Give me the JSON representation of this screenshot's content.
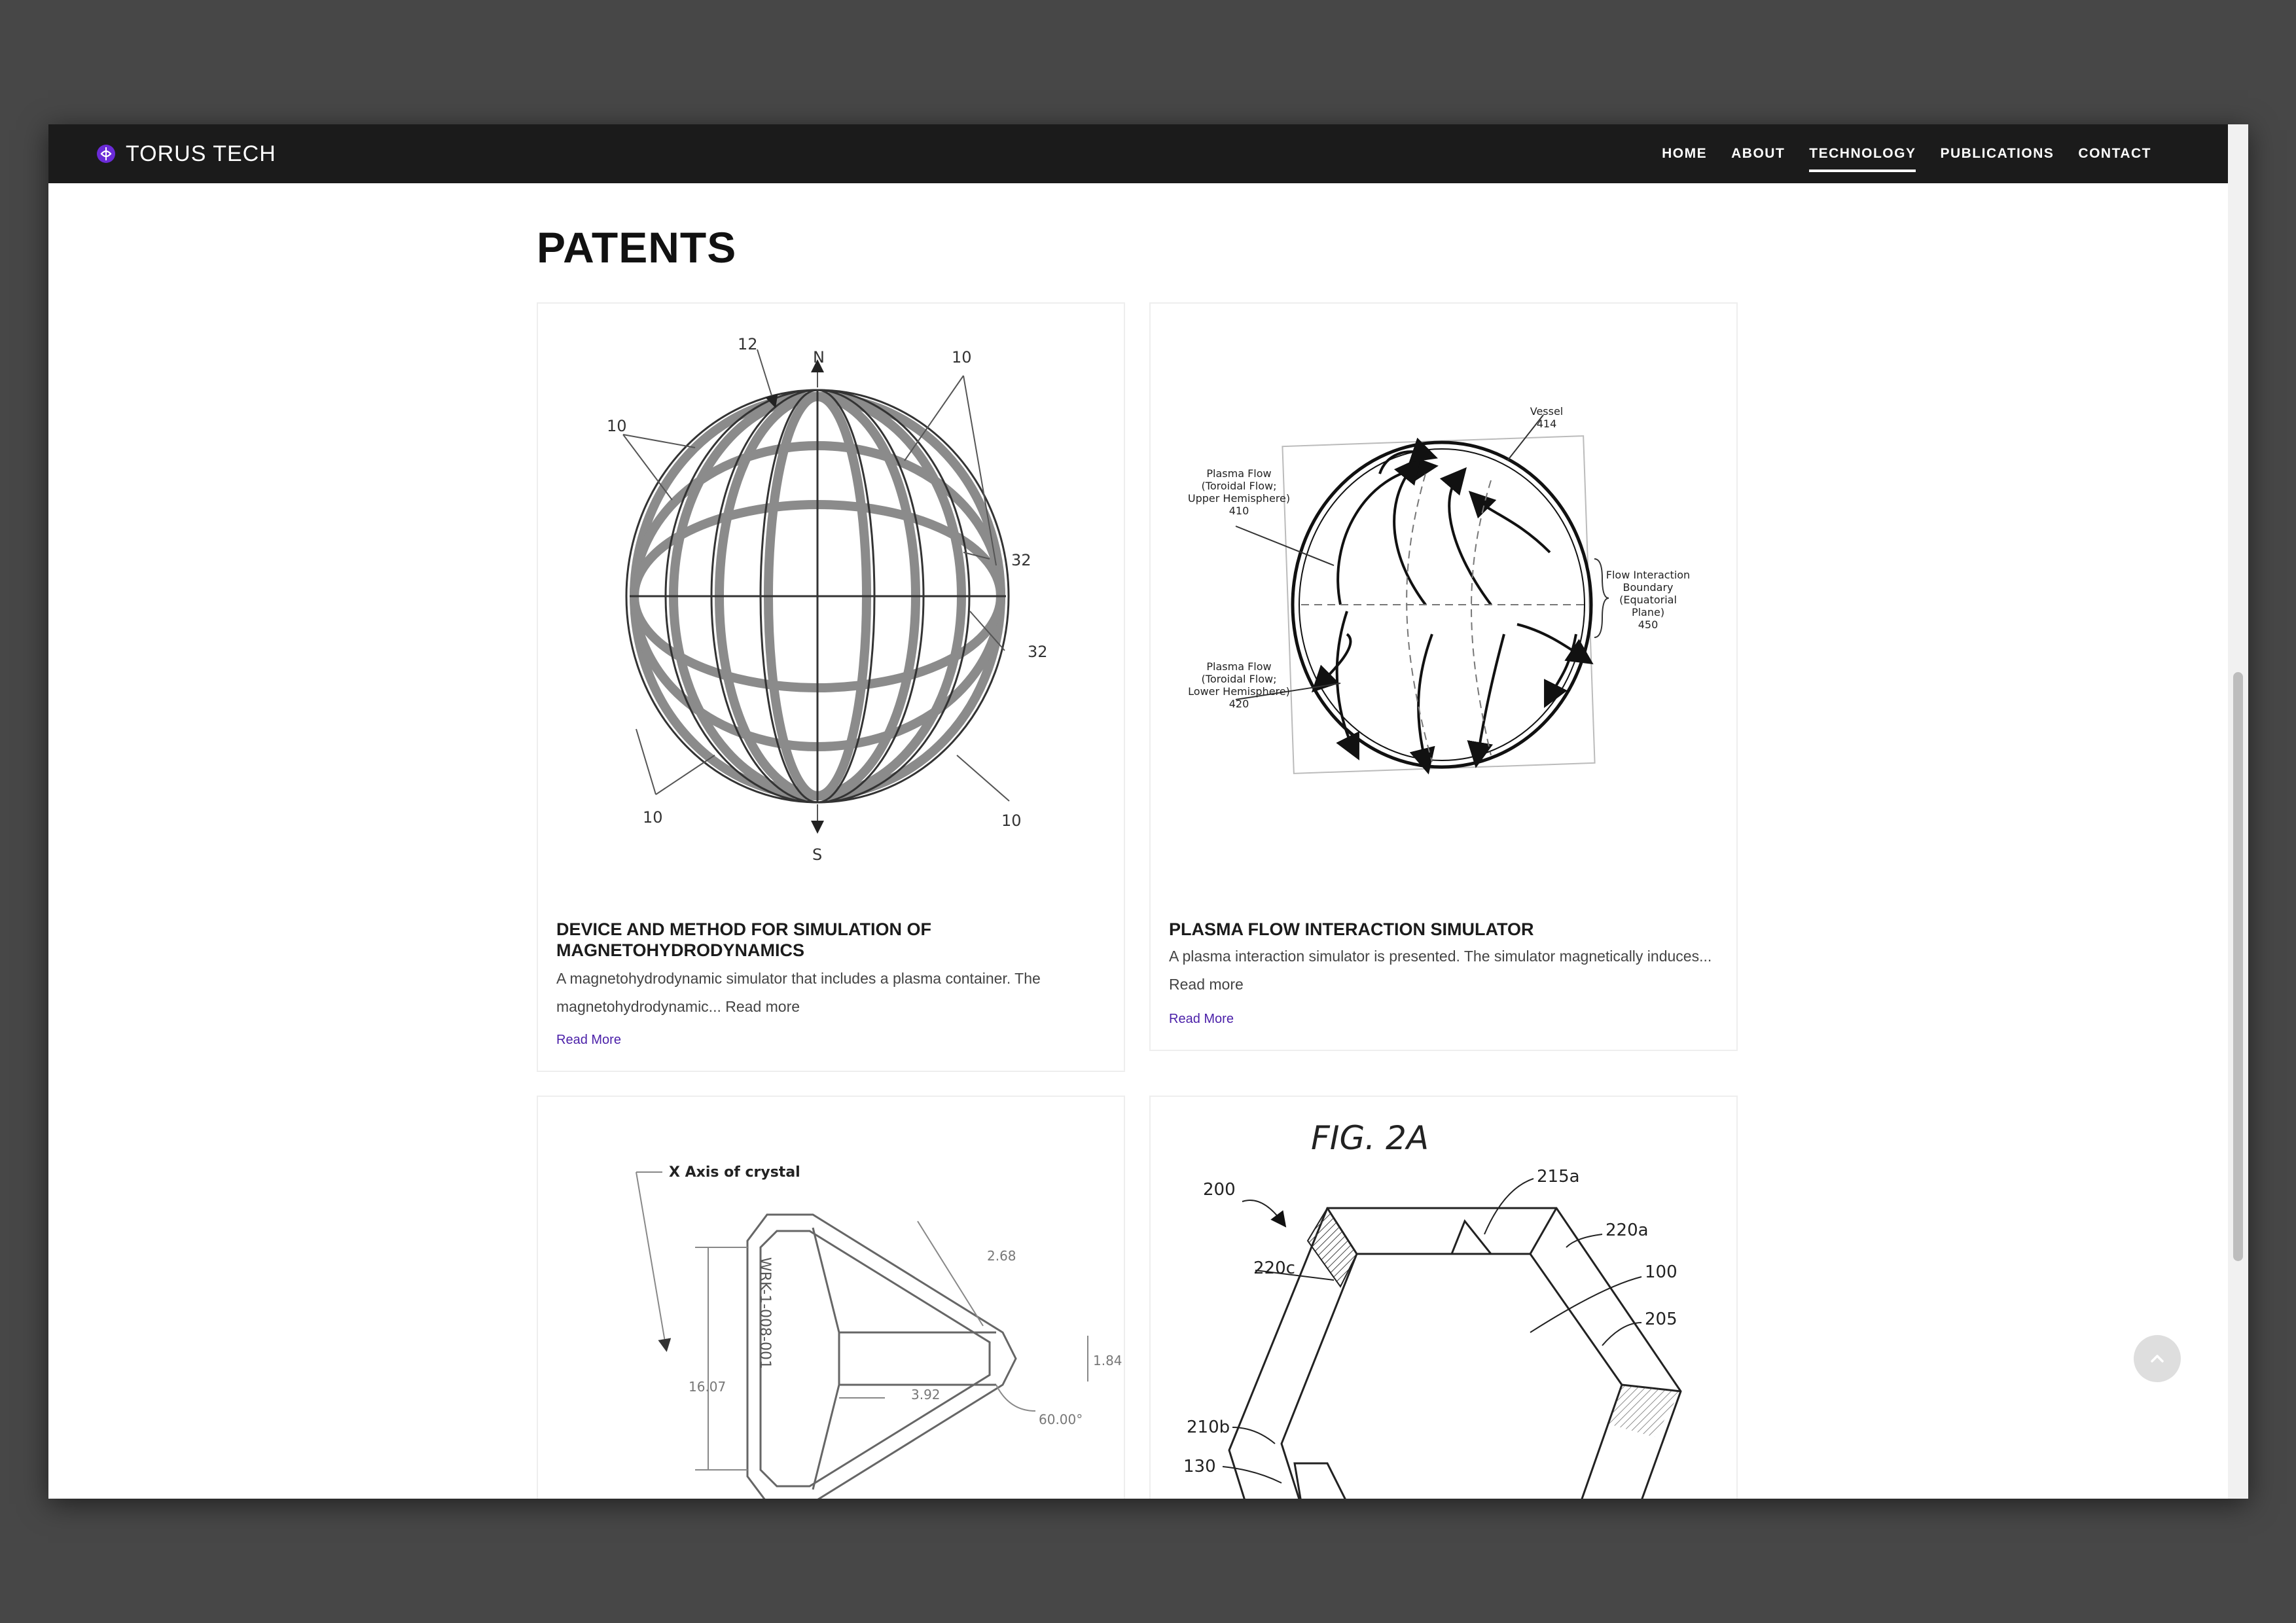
{
  "brand": {
    "name": "TORUS TECH",
    "logo_icon": "torus-logo-icon",
    "accent": "#6b2bd8"
  },
  "nav": {
    "items": [
      {
        "label": "HOME",
        "active": false
      },
      {
        "label": "ABOUT",
        "active": false
      },
      {
        "label": "TECHNOLOGY",
        "active": true
      },
      {
        "label": "PUBLICATIONS",
        "active": false
      },
      {
        "label": "CONTACT",
        "active": false
      }
    ]
  },
  "page": {
    "heading": "PATENTS"
  },
  "cards": [
    {
      "title": "DEVICE AND METHOD FOR SIMULATION OF MAGNETOHYDRODYNAMICS",
      "excerpt": "A magnetohydrodynamic simulator that includes a plasma container. The magnetohydrodynamic... Read more",
      "link": "Read More",
      "figure_labels": {
        "n": "N",
        "s": "S",
        "l12": "12",
        "l10a": "10",
        "l10b": "10",
        "l10c": "10",
        "l10d": "10",
        "l32a": "32",
        "l32b": "32"
      }
    },
    {
      "title": "PLASMA FLOW INTERACTION SIMULATOR",
      "excerpt": "A plasma interaction simulator is presented. The simulator magnetically induces... Read more",
      "link": "Read More",
      "figure_labels": {
        "vessel": "Vessel",
        "vessel_num": "414",
        "upper_1": "Plasma Flow",
        "upper_2": "(Toroidal Flow;",
        "upper_3": "Upper Hemisphere)",
        "upper_num": "410",
        "lower_1": "Plasma Flow",
        "lower_2": "(Toroidal Flow;",
        "lower_3": "Lower Hemisphere)",
        "lower_num": "420",
        "boundary_1": "Flow Interaction",
        "boundary_2": "Boundary",
        "boundary_3": "(Equatorial",
        "boundary_4": "Plane)",
        "boundary_num": "450"
      }
    },
    {
      "figure_labels": {
        "axis": "X Axis of crystal",
        "d1": "2.68",
        "d2": "1.84",
        "d3": "16.07",
        "d4": "3.92",
        "angle": "60.00°",
        "part": "WRK-1-008-001"
      }
    },
    {
      "figure_labels": {
        "fig": "FIG. 2A",
        "l200": "200",
        "l215a": "215a",
        "l220a": "220a",
        "l220c": "220c",
        "l100": "100",
        "l205": "205",
        "l210b": "210b",
        "l130": "130"
      }
    }
  ],
  "back_to_top_icon": "chevron-up-icon"
}
